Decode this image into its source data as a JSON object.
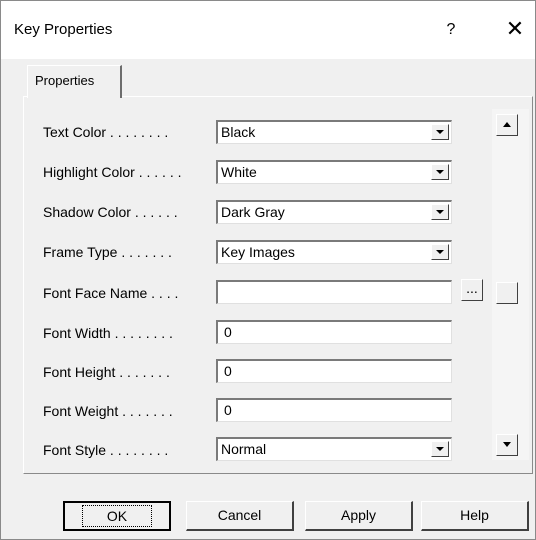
{
  "window": {
    "title": "Key Properties",
    "help_label": "?",
    "close_label": "✕"
  },
  "tabs": [
    {
      "label": "Properties",
      "selected": true
    }
  ],
  "fields": [
    {
      "label": "Text Color . . . . . . . .",
      "type": "combo",
      "value": "Black"
    },
    {
      "label": "Highlight Color . . . . . .",
      "type": "combo",
      "value": "White"
    },
    {
      "label": "Shadow Color . . . . . .",
      "type": "combo",
      "value": "Dark Gray"
    },
    {
      "label": "Frame Type . . . . . . .",
      "type": "combo",
      "value": "Key Images"
    },
    {
      "label": "Font Face Name . . . .",
      "type": "edit-browse",
      "value": ""
    },
    {
      "label": "Font Width . . . . . . . .",
      "type": "edit",
      "value": "0"
    },
    {
      "label": "Font Height . . . . . . .",
      "type": "edit",
      "value": "0"
    },
    {
      "label": "Font Weight . . . . . . .",
      "type": "edit",
      "value": "0"
    },
    {
      "label": "Font Style . . . . . . . .",
      "type": "combo",
      "value": "Normal"
    }
  ],
  "browse_button_label": "...",
  "buttons": {
    "ok": "OK",
    "cancel": "Cancel",
    "apply": "Apply",
    "help": "Help"
  },
  "icons": {
    "combo_arrow": "chevron-down-icon",
    "scroll_up": "scroll-up-arrow-icon",
    "scroll_down": "scroll-down-arrow-icon"
  }
}
